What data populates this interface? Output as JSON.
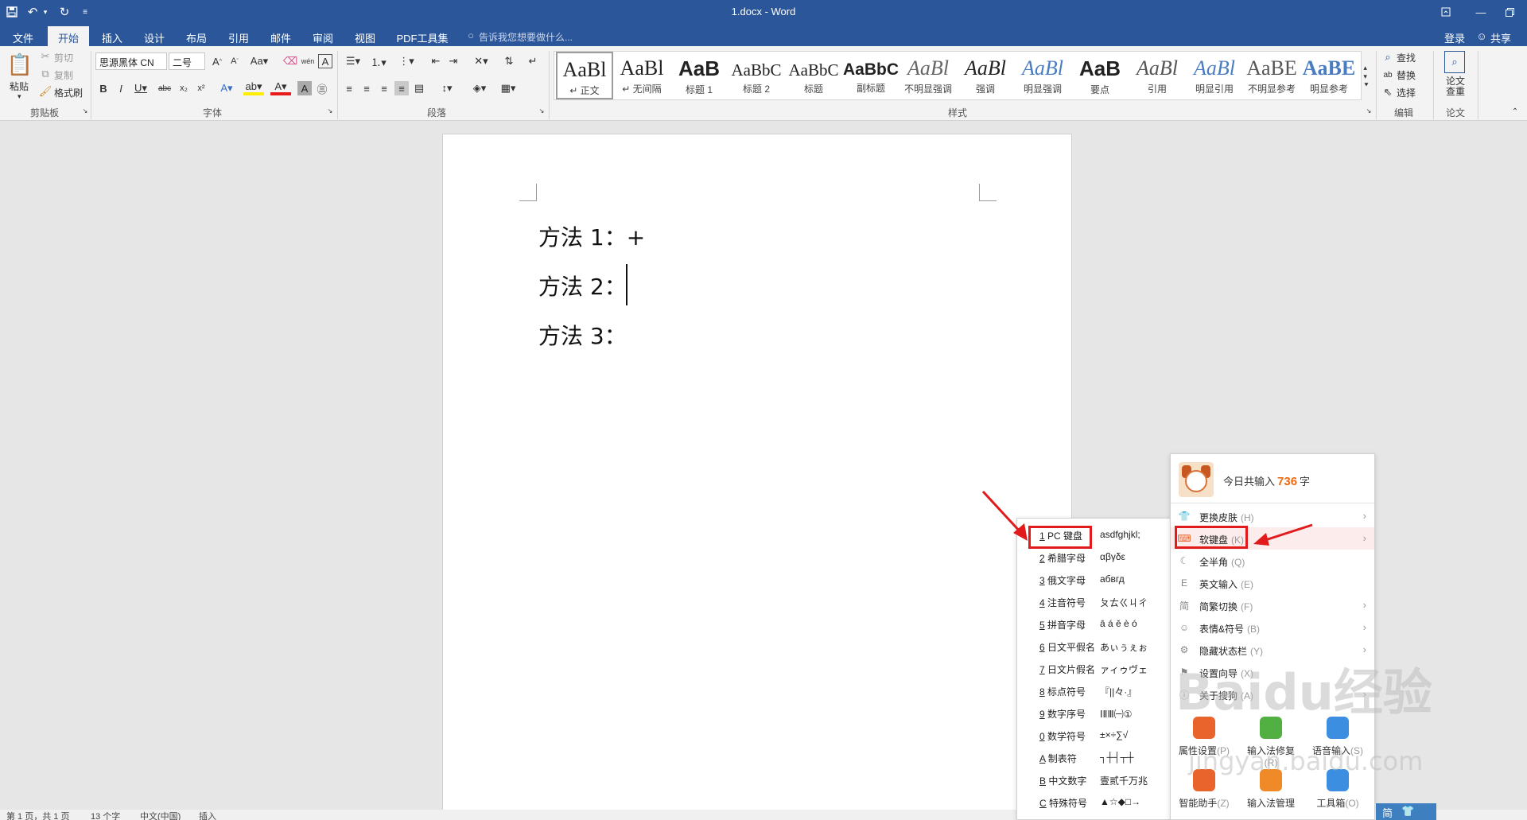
{
  "titlebar": {
    "doc_title": "1.docx - Word",
    "quick_access": [
      "save-icon",
      "undo-icon",
      "redo-icon",
      "customize-icon"
    ],
    "window_controls": [
      "ribbon-display-icon",
      "minimize-icon",
      "restore-icon",
      "close-icon"
    ]
  },
  "tabs": [
    "文件",
    "开始",
    "插入",
    "设计",
    "布局",
    "引用",
    "邮件",
    "审阅",
    "视图",
    "PDF工具集"
  ],
  "active_tab": "开始",
  "tell_me": "告诉我您想要做什么...",
  "login": "登录",
  "share": "共享",
  "clipboard": {
    "paste": "粘贴",
    "cut": "剪切",
    "copy": "复制",
    "format_painter": "格式刷",
    "label": "剪贴板"
  },
  "font": {
    "family": "思源黑体 CN",
    "size": "二号",
    "label": "字体"
  },
  "paragraph": {
    "label": "段落"
  },
  "styles": {
    "label": "样式",
    "items": [
      {
        "sample": "AaBl",
        "name": "↵ 正文"
      },
      {
        "sample": "AaBl",
        "name": "↵ 无间隔"
      },
      {
        "sample": "AaB",
        "name": "标题 1"
      },
      {
        "sample": "AaBbC",
        "name": "标题 2"
      },
      {
        "sample": "AaBbC",
        "name": "标题"
      },
      {
        "sample": "AaBbC",
        "name": "副标题"
      },
      {
        "sample": "AaBl",
        "name": "不明显强调"
      },
      {
        "sample": "AaBl",
        "name": "强调"
      },
      {
        "sample": "AaBl",
        "name": "明显强调"
      },
      {
        "sample": "AaB",
        "name": "要点"
      },
      {
        "sample": "AaBl",
        "name": "引用"
      },
      {
        "sample": "AaBl",
        "name": "明显引用"
      },
      {
        "sample": "AaBE",
        "name": "不明显参考"
      },
      {
        "sample": "AaBE",
        "name": "明显参考"
      }
    ]
  },
  "editing": {
    "find": "查找",
    "replace": "替换",
    "select": "选择",
    "label": "编辑"
  },
  "paper": {
    "check": "论文查重",
    "label": "论文"
  },
  "document": {
    "lines": [
      "方法 1：+",
      "方法 2：",
      "方法 3："
    ]
  },
  "statusbar": {
    "page": "第 1 页，共 1 页",
    "words": "13 个字",
    "language": "中文(中国)",
    "mode": "插入"
  },
  "ime_menu": {
    "header_prefix": "今日共输入",
    "header_count": "736",
    "header_suffix": "字",
    "items": [
      {
        "icon": "shirt-icon",
        "label": "更换皮肤",
        "key": "(H)",
        "arrow": true
      },
      {
        "icon": "keyboard-icon",
        "label": "软键盘",
        "key": "(K)",
        "arrow": true
      },
      {
        "icon": "moon-icon",
        "label": "全半角",
        "key": "(Q)",
        "arrow": false
      },
      {
        "icon": "letter-e-icon",
        "label": "英文输入",
        "key": "(E)",
        "arrow": false
      },
      {
        "icon": "simplified-icon",
        "label": "简繁切换",
        "key": "(F)",
        "arrow": true
      },
      {
        "icon": "smiley-icon",
        "label": "表情&符号",
        "key": "(B)",
        "arrow": true
      },
      {
        "icon": "toolbar-icon",
        "label": "隐藏状态栏",
        "key": "(Y)",
        "arrow": true
      },
      {
        "icon": "flag-icon",
        "label": "设置向导",
        "key": "(X)",
        "arrow": false
      },
      {
        "icon": "info-icon",
        "label": "关于搜狗",
        "key": "(A)",
        "arrow": true
      }
    ],
    "tools": [
      {
        "icon": "settings-tool-icon",
        "label": "属性设置",
        "key": "(P)",
        "color": "#e8642c"
      },
      {
        "icon": "repair-tool-icon",
        "label": "输入法修复",
        "key": "(R)",
        "color": "#52b043"
      },
      {
        "icon": "voice-tool-icon",
        "label": "语音输入",
        "key": "(S)",
        "color": "#3c8fe0"
      },
      {
        "icon": "assistant-tool-icon",
        "label": "智能助手",
        "key": "(Z)",
        "color": "#e8642c"
      },
      {
        "icon": "manage-tool-icon",
        "label": "输入法管理",
        "key": "",
        "color": "#f08a28"
      },
      {
        "icon": "toolbox-tool-icon",
        "label": "工具箱",
        "key": "(O)",
        "color": "#3c8fe0"
      }
    ]
  },
  "soft_keyboard_menu": {
    "items": [
      {
        "num": "1",
        "label": "PC 键盘",
        "sample": "asdfghjkl;"
      },
      {
        "num": "2",
        "label": "希腊字母",
        "sample": "αβγδε"
      },
      {
        "num": "3",
        "label": "俄文字母",
        "sample": "абвгд"
      },
      {
        "num": "4",
        "label": "注音符号",
        "sample": "ㄆㄊㄍㄐㄔ"
      },
      {
        "num": "5",
        "label": "拼音字母",
        "sample": "ā á ě è ó"
      },
      {
        "num": "6",
        "label": "日文平假名",
        "sample": "あぃぅぇぉ"
      },
      {
        "num": "7",
        "label": "日文片假名",
        "sample": "ァィゥヴェ"
      },
      {
        "num": "8",
        "label": "标点符号",
        "sample": "『||々·』"
      },
      {
        "num": "9",
        "label": "数字序号",
        "sample": "ⅠⅡⅢ㈠①"
      },
      {
        "num": "0",
        "label": "数学符号",
        "sample": "±×÷∑√"
      },
      {
        "num": "A",
        "label": "制表符",
        "sample": "┐┼┤┬┼"
      },
      {
        "num": "B",
        "label": "中文数字",
        "sample": "壹贰千万兆"
      },
      {
        "num": "C",
        "label": "特殊符号",
        "sample": "▲☆◆□→"
      }
    ]
  },
  "taskbar_ime": {
    "mode": "简"
  },
  "watermark": {
    "brand": "Baidu经验",
    "url": "jingyan.baidu.com"
  },
  "colors": {
    "title_bar": "#2b579a",
    "highlight_box": "#e11b1b",
    "ime_count": "#f06a10"
  }
}
